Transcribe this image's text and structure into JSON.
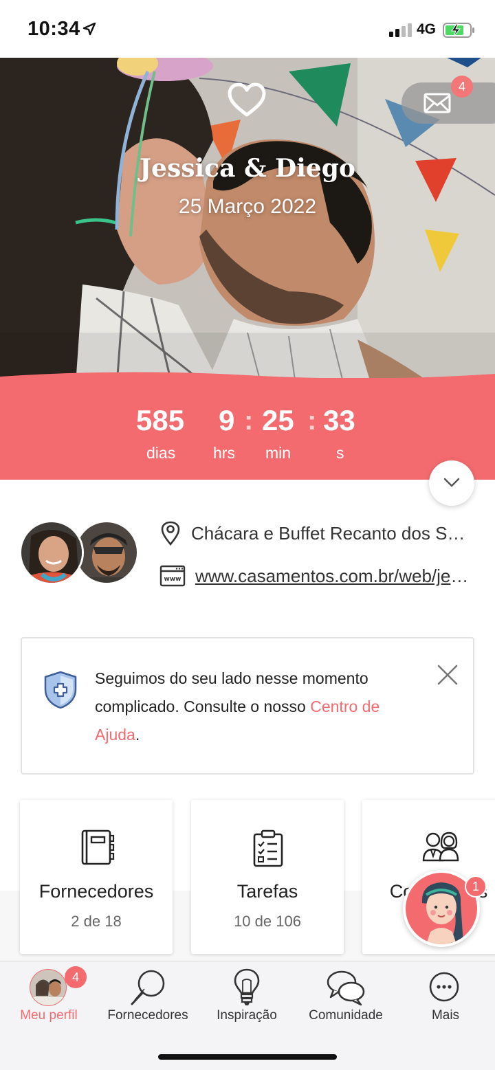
{
  "status_bar": {
    "time": "10:34",
    "network": "4G",
    "icons": [
      "location-arrow-icon",
      "signal-icon",
      "battery-charging-icon"
    ]
  },
  "hero": {
    "couple_names": "Jessica & Diego",
    "wedding_date": "25 Março 2022",
    "message_badge": "4",
    "icons": [
      "heart-logo-icon",
      "envelope-icon"
    ]
  },
  "countdown": {
    "days": "585",
    "hours": "9",
    "minutes": "25",
    "seconds": "33",
    "separator": ":",
    "days_label": "dias",
    "hours_label": "hrs",
    "minutes_label": "min",
    "seconds_label": "s"
  },
  "couple_info": {
    "venue": "Chácara e Buffet Recanto dos Sonhos",
    "website": "www.casamentos.com.br/web/jessica-e-diego",
    "icons": [
      "map-pin-icon",
      "www-icon"
    ]
  },
  "notice": {
    "text_before": "Seguimos do seu lado nesse momento complicado. Consulte o nosso ",
    "link_text": "Centro de Ajuda",
    "text_after": ".",
    "icons": [
      "shield-plus-icon",
      "close-icon"
    ]
  },
  "cards": [
    {
      "title": "Fornecedores",
      "subtitle": "2 de 18",
      "icon": "notebook-icon"
    },
    {
      "title": "Tarefas",
      "subtitle": "10 de 106",
      "icon": "checklist-icon"
    },
    {
      "title": "Convidados",
      "subtitle": "",
      "icon": "guests-icon"
    }
  ],
  "assistant": {
    "badge": "1"
  },
  "tab_bar": {
    "items": [
      {
        "label": "Meu perfil",
        "active": true,
        "badge": "4",
        "icon": "profile-avatar-icon"
      },
      {
        "label": "Fornecedores",
        "active": false,
        "icon": "magnifier-icon"
      },
      {
        "label": "Inspiração",
        "active": false,
        "icon": "lightbulb-icon"
      },
      {
        "label": "Comunidade",
        "active": false,
        "icon": "chat-bubbles-icon"
      },
      {
        "label": "Mais",
        "active": false,
        "icon": "more-dots-icon"
      }
    ]
  },
  "colors": {
    "accent": "#f36b6f",
    "badge": "#f37777",
    "text": "#222222",
    "muted": "#666666",
    "tabbar_bg": "#f4f4f6"
  }
}
